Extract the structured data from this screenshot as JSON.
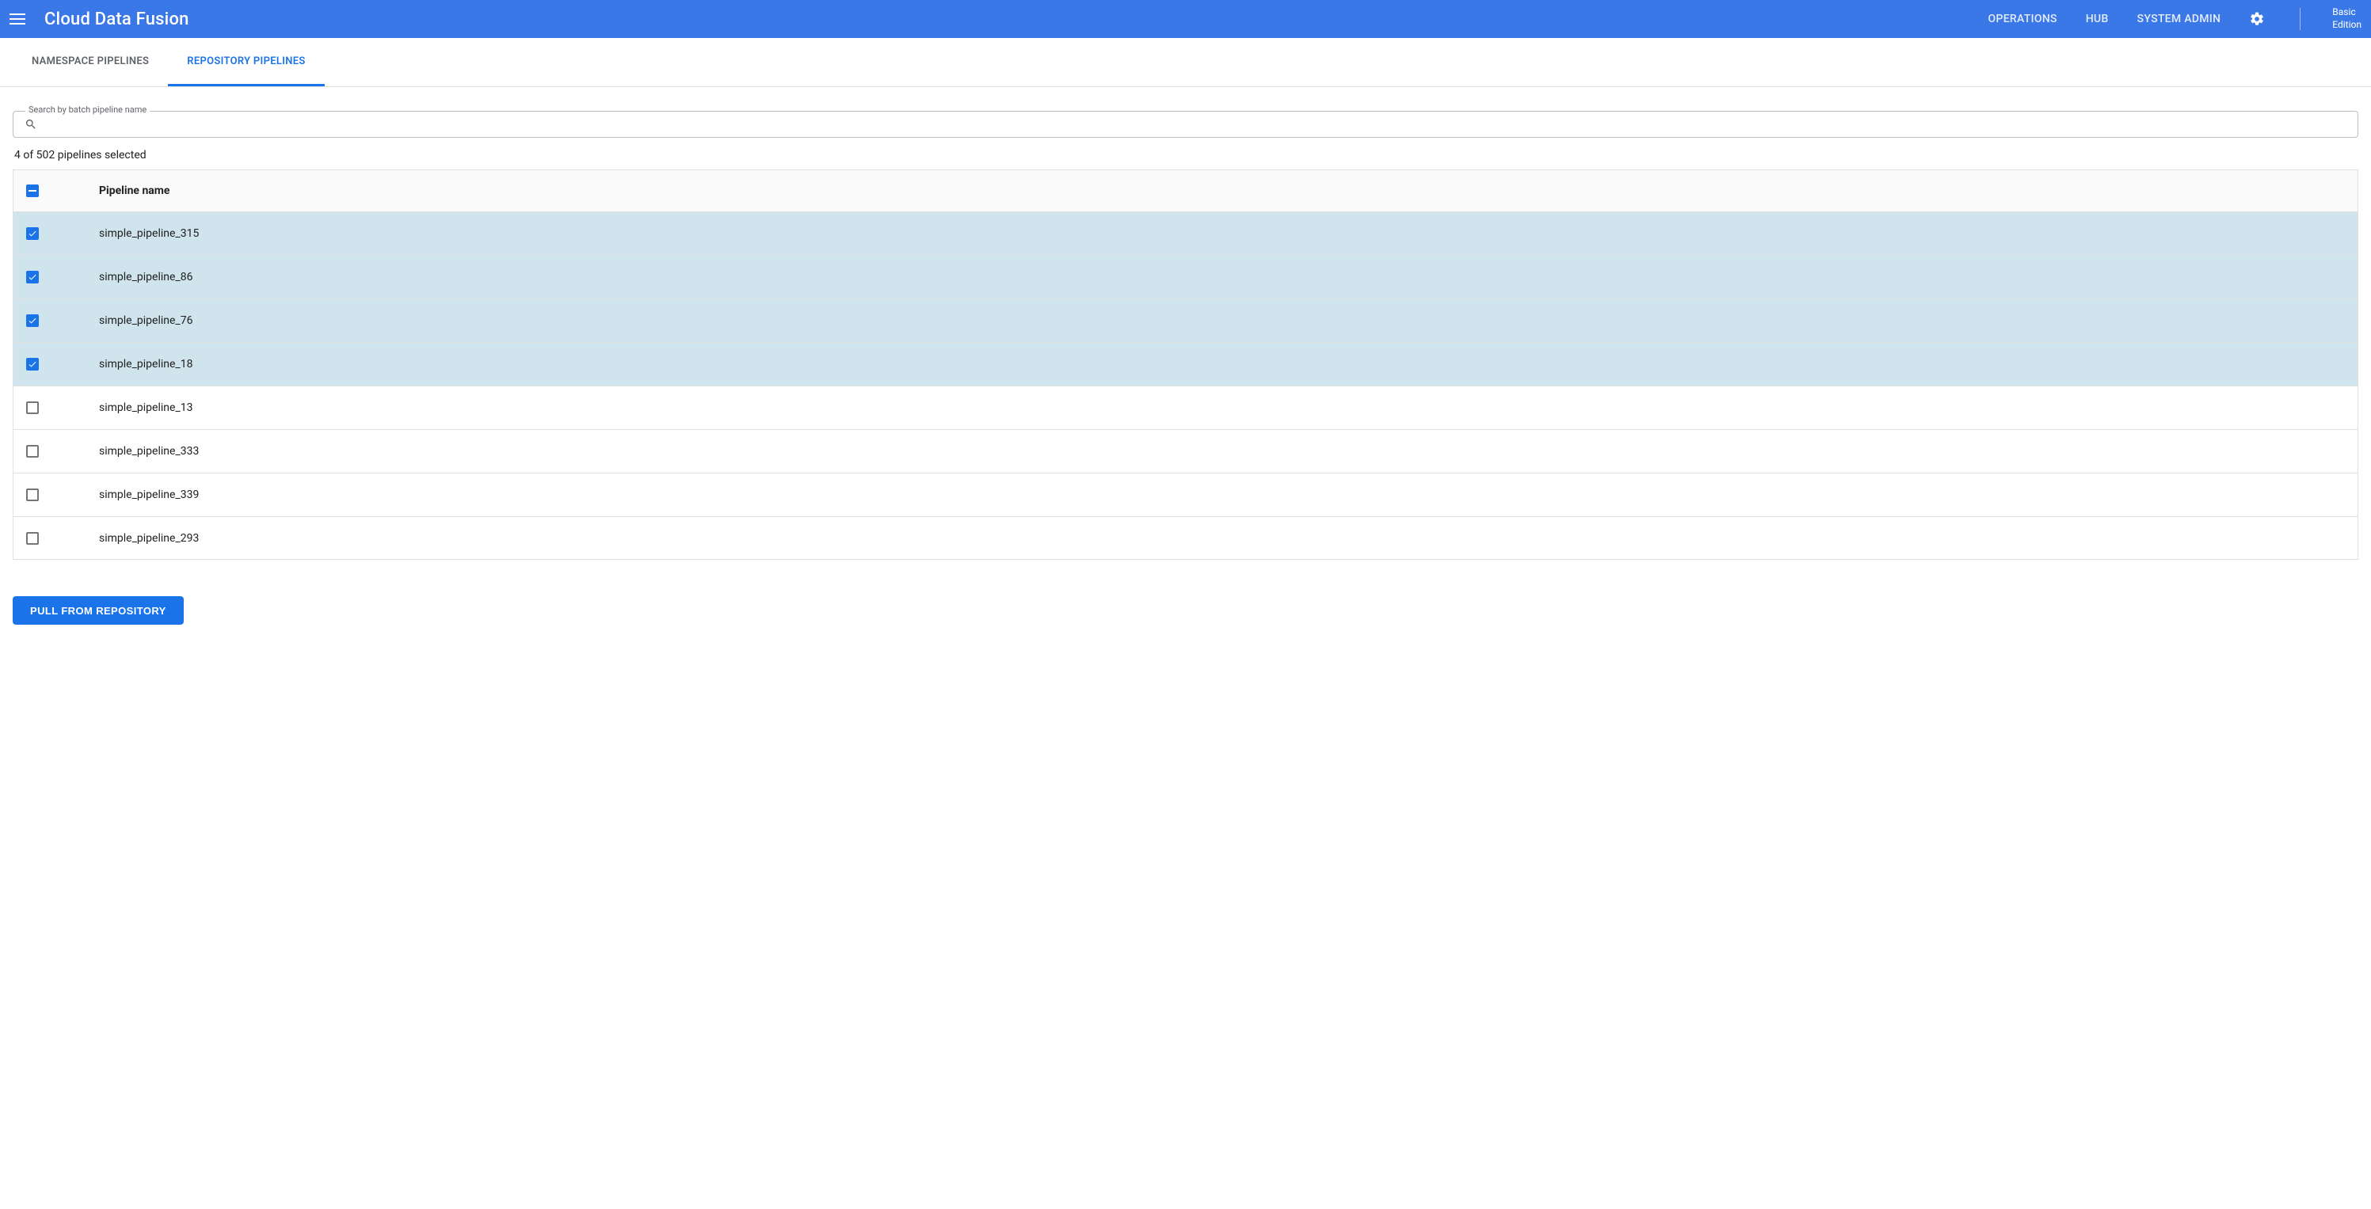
{
  "header": {
    "app_title": "Cloud Data Fusion",
    "nav": {
      "operations": "OPERATIONS",
      "hub": "HUB",
      "system_admin": "SYSTEM ADMIN"
    },
    "edition_line1": "Basic",
    "edition_line2": "Edition"
  },
  "tabs": {
    "namespace": "NAMESPACE PIPELINES",
    "repository": "REPOSITORY PIPELINES"
  },
  "search": {
    "label": "Search by batch pipeline name",
    "placeholder": ""
  },
  "selection_text": "4 of 502 pipelines selected",
  "table": {
    "header_name": "Pipeline name",
    "rows": [
      {
        "name": "simple_pipeline_315",
        "selected": true
      },
      {
        "name": "simple_pipeline_86",
        "selected": true
      },
      {
        "name": "simple_pipeline_76",
        "selected": true
      },
      {
        "name": "simple_pipeline_18",
        "selected": true
      },
      {
        "name": "simple_pipeline_13",
        "selected": false
      },
      {
        "name": "simple_pipeline_333",
        "selected": false
      },
      {
        "name": "simple_pipeline_339",
        "selected": false
      },
      {
        "name": "simple_pipeline_293",
        "selected": false
      }
    ]
  },
  "actions": {
    "pull": "PULL FROM REPOSITORY"
  }
}
